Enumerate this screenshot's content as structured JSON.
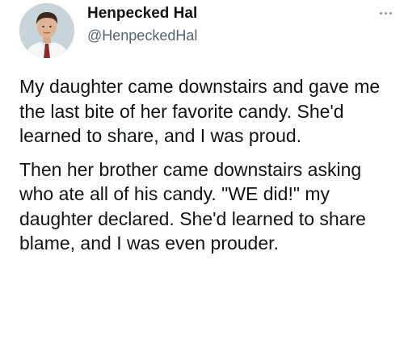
{
  "author": {
    "display_name": "Henpecked Hal",
    "handle": "@HenpeckedHal",
    "avatar_icon": "profile-photo"
  },
  "menu": {
    "icon": "more-options-icon"
  },
  "tweet": {
    "paragraph_1": "My daughter came downstairs and gave me the last bite of her favorite candy. She'd learned to share, and I was proud.",
    "paragraph_2": "Then her brother came downstairs asking who ate all of his candy. \"WE did!\" my daughter declared. She'd learned to share blame, and I was even prouder."
  },
  "colors": {
    "text": "#0f1419",
    "secondary_text": "#536471",
    "background": "#ffffff"
  }
}
